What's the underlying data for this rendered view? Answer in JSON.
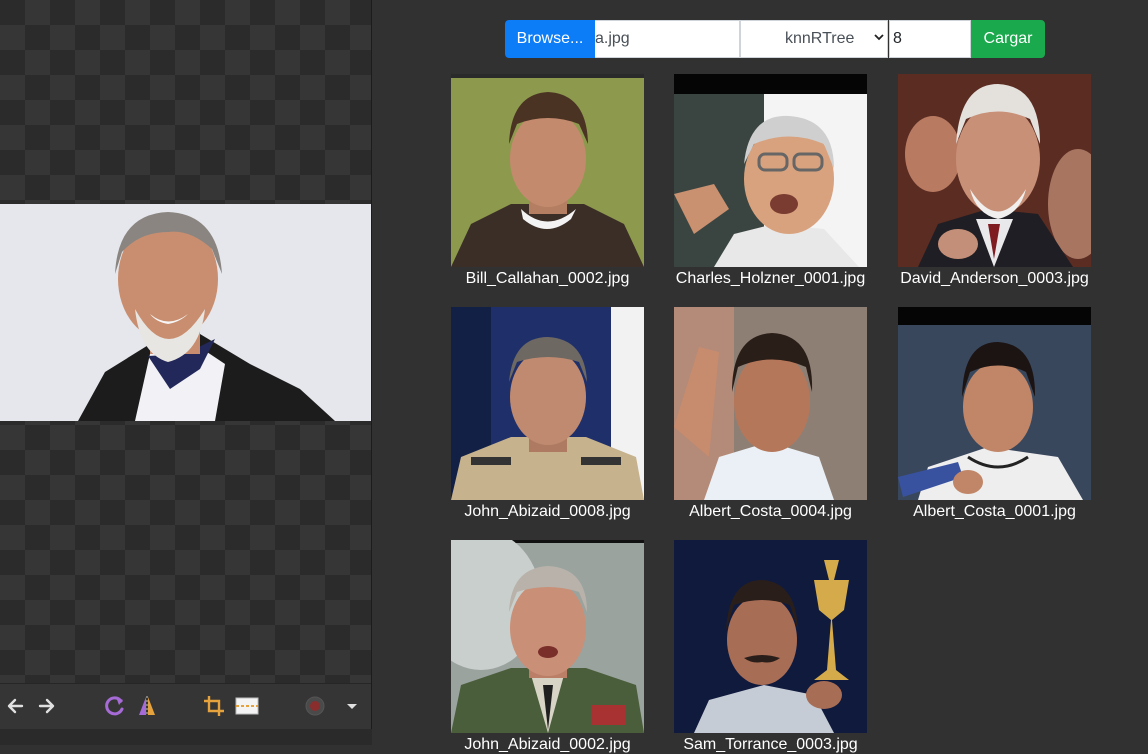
{
  "toolbar": {
    "browse_label": "Browse...",
    "file_name": "a.jpg",
    "algorithm": "knnRTree",
    "k_value": "8",
    "load_label": "Cargar"
  },
  "results": [
    {
      "filename": "Bill_Callahan_0002.jpg"
    },
    {
      "filename": "Charles_Holzner_0001.jpg"
    },
    {
      "filename": "David_Anderson_0003.jpg"
    },
    {
      "filename": "John_Abizaid_0008.jpg"
    },
    {
      "filename": "Albert_Costa_0004.jpg"
    },
    {
      "filename": "Albert_Costa_0001.jpg"
    },
    {
      "filename": "John_Abizaid_0002.jpg"
    },
    {
      "filename": "Sam_Torrance_0003.jpg"
    }
  ],
  "colors": {
    "browse_button": "#0d7cf7",
    "load_button": "#1aa94d",
    "panel_background": "#313131"
  },
  "viewer_icons": [
    "arrow-left-icon",
    "arrow-right-icon",
    "rotate-icon",
    "flip-icon",
    "crop-icon",
    "image-icon",
    "record-icon",
    "dropdown-icon"
  ]
}
